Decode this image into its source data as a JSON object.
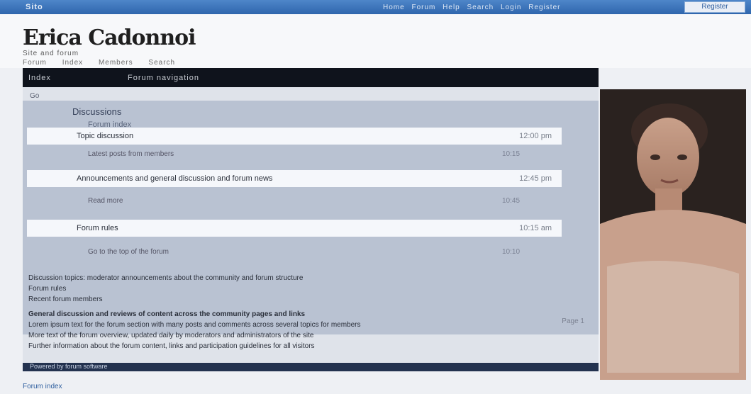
{
  "topbar": {
    "brand": "Sito",
    "links": [
      "Home",
      "Forum",
      "Help",
      "Search",
      "Login",
      "Register"
    ],
    "button": "Register"
  },
  "header": {
    "title": "Erica Cadonnoi",
    "tagline": "Site and forum",
    "subnav": [
      "Forum",
      "Index",
      "Members",
      "Search"
    ]
  },
  "panel": {
    "bar_left": "Index",
    "bar_right": "Forum navigation",
    "crumb": "Go",
    "group_title": "Discussions",
    "group_sub": "Forum index",
    "rows": [
      {
        "label": "Topic discussion",
        "meta": "12:00 pm"
      },
      {
        "label": "Announcements and general discussion and forum news",
        "meta": "12:45 pm"
      },
      {
        "label": "Forum rules",
        "meta": "10:15 am"
      }
    ],
    "row_sub": [
      "Latest posts from members",
      "Read more",
      "Go to the top of the forum"
    ],
    "row_subr": [
      "10:15",
      "10:45",
      "10:10"
    ],
    "pager": "Page 1",
    "body": [
      "Discussion topics: moderator announcements about the community and forum structure",
      "Forum rules",
      "Recent forum members",
      "General discussion and reviews of content across the community pages and links",
      "Lorem ipsum text for the forum section with many posts and comments across several topics for members",
      "More text of the forum overview, updated daily by moderators and administrators of the site",
      "Further information about the forum content, links and participation guidelines for all visitors"
    ],
    "footer": "Powered by forum software"
  },
  "bottom": "Forum index",
  "colors": {
    "topbar": "#2f66ad",
    "panel_bar": "#0f131c",
    "list_bg": "#b9c2d2"
  }
}
